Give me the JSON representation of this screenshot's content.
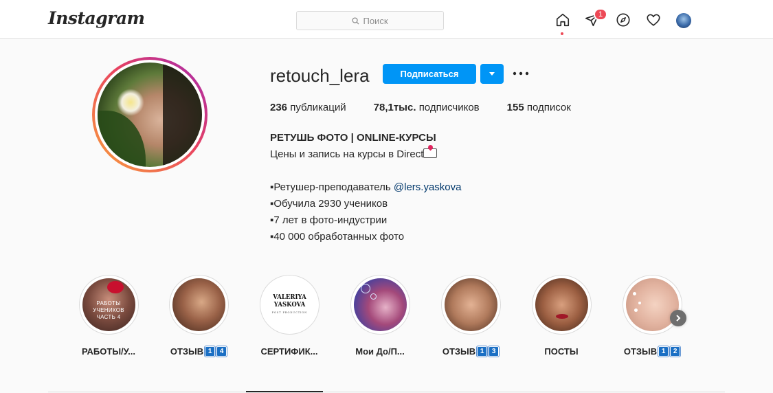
{
  "header": {
    "logo": "Instagram",
    "search_placeholder": "Поиск",
    "notifications_count": "1"
  },
  "profile": {
    "username": "retouch_lera",
    "follow_label": "Подписаться",
    "stats": {
      "posts_count": "236",
      "posts_label": "публикаций",
      "followers_count": "78,1тыс.",
      "followers_label": "подписчиков",
      "following_count": "155",
      "following_label": "подписок"
    },
    "bio": {
      "name": "РЕТУШЬ ФОТО | ONLINE-КУРСЫ",
      "line1": "Цены и запись на курсы в Direct",
      "line3_prefix": "▪Ретушер-преподаватель ",
      "mention": "@lers.yaskova",
      "line4": "▪Обучила 2930 учеников",
      "line5": "▪7 лет в фото-индустрии",
      "line6": "▪40 000 обработанных фото"
    }
  },
  "highlights": [
    {
      "label": "РАБОТЫ/У...",
      "overlay": "РАБОТЫ УЧЕНИКОВ\nЧАСТЬ 4"
    },
    {
      "label": "ОТЗЫВ",
      "badges": [
        "1",
        "4"
      ]
    },
    {
      "label": "СЕРТИФИК...",
      "cover_title": "VALERIYA YASKOVA",
      "cover_sub": "POST PRODUCTION"
    },
    {
      "label": "Мои До/П..."
    },
    {
      "label": "ОТЗЫВ",
      "badges": [
        "1",
        "3"
      ]
    },
    {
      "label": "ПОСТЫ"
    },
    {
      "label": "ОТЗЫВ",
      "badges": [
        "1",
        "2"
      ]
    }
  ],
  "colors": {
    "accent": "#0095f6",
    "badge_red": "#ed4956",
    "mention": "#00376b"
  }
}
